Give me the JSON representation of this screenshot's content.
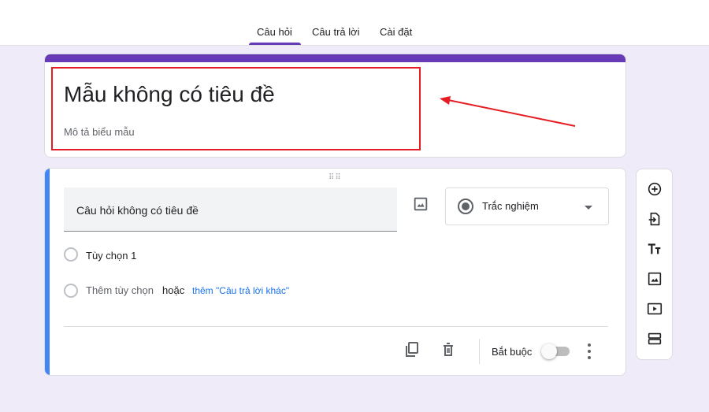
{
  "tabs": [
    {
      "label": "Câu hỏi",
      "active": true
    },
    {
      "label": "Câu trả lời",
      "active": false
    },
    {
      "label": "Cài đặt",
      "active": false
    }
  ],
  "form": {
    "title": "Mẫu không có tiêu đề",
    "description_placeholder": "Mô tả biểu mẫu"
  },
  "question": {
    "title": "Câu hỏi không có tiêu đề",
    "type_label": "Trắc nghiệm",
    "options": [
      "Tùy chọn 1"
    ],
    "add_option": "Thêm tùy chọn",
    "or_text": "hoặc",
    "add_other": "thêm \"Câu trả lời khác\"",
    "required_label": "Bắt buộc",
    "required_on": false
  },
  "sidebar_icons": [
    "add-question-icon",
    "import-question-icon",
    "title-text-icon",
    "image-icon",
    "video-icon",
    "section-icon"
  ],
  "colors": {
    "accent": "#673ab7",
    "active_question": "#4285f4",
    "background": "#f0ebf8",
    "annotation": "#e51c23"
  }
}
